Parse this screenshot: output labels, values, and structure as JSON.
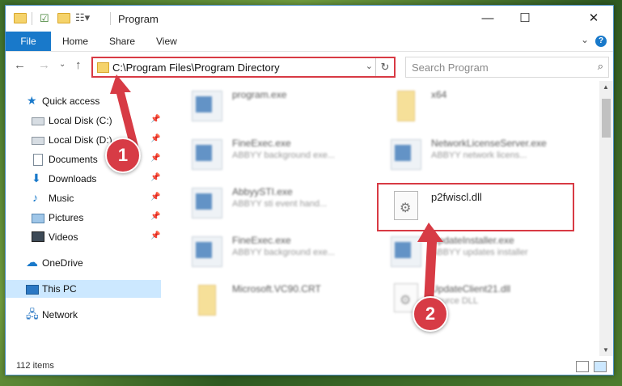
{
  "window": {
    "title": "Program",
    "controls": {
      "minimize": "—",
      "maximize": "☐",
      "close": "✕"
    }
  },
  "ribbon": {
    "tabs": [
      "File",
      "Home",
      "Share",
      "View"
    ]
  },
  "nav": {
    "address": "C:\\Program Files\\Program Directory",
    "search_placeholder": "Search Program"
  },
  "sidebar": {
    "items": [
      {
        "label": "Quick access",
        "icon": "star-icon"
      },
      {
        "label": "Local Disk (C:)",
        "icon": "disk-icon",
        "pinned": true
      },
      {
        "label": "Local Disk (D:)",
        "icon": "disk-icon",
        "pinned": true
      },
      {
        "label": "Documents",
        "icon": "document-icon",
        "pinned": true
      },
      {
        "label": "Downloads",
        "icon": "download-icon",
        "pinned": true
      },
      {
        "label": "Music",
        "icon": "music-icon",
        "pinned": true
      },
      {
        "label": "Pictures",
        "icon": "pictures-icon",
        "pinned": true
      },
      {
        "label": "Videos",
        "icon": "videos-icon",
        "pinned": true
      },
      {
        "label": "OneDrive",
        "icon": "cloud-icon"
      },
      {
        "label": "This PC",
        "icon": "computer-icon",
        "selected": true
      },
      {
        "label": "Network",
        "icon": "network-icon"
      }
    ]
  },
  "files": [
    {
      "name": "program.exe",
      "desc": "",
      "icon": "exe-icon"
    },
    {
      "name": "x64",
      "desc": "",
      "icon": "folder-icon"
    },
    {
      "name": "FineExec.exe",
      "desc": "ABBYY background exe...",
      "icon": "exe-icon"
    },
    {
      "name": "NetworkLicenseServer.exe",
      "desc": "ABBYY network licens...",
      "icon": "exe-icon"
    },
    {
      "name": "AbbyySTI.exe",
      "desc": "ABBYY sti event hand...",
      "icon": "exe-icon"
    },
    {
      "name": "p2fwiscl.dll",
      "desc": "",
      "icon": "dll-icon"
    },
    {
      "name": "FineExec.exe",
      "desc": "ABBYY background exe...",
      "icon": "exe-icon"
    },
    {
      "name": "UpdateInstaller.exe",
      "desc": "ABBYY updates installer",
      "icon": "exe-icon"
    },
    {
      "name": "Microsoft.VC90.CRT",
      "desc": "",
      "icon": "folder-icon"
    },
    {
      "name": "UpdateClient21.dll",
      "desc": "Source DLL",
      "icon": "dll-icon"
    }
  ],
  "status": {
    "count": "112 items"
  },
  "callouts": {
    "one": "1",
    "two": "2"
  },
  "colors": {
    "accent": "#1979ca",
    "highlight": "#d83a44"
  }
}
